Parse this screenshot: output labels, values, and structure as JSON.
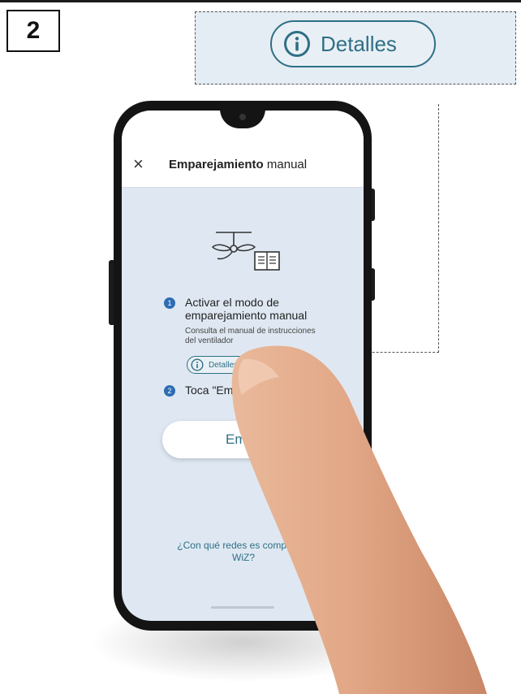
{
  "step_number": "2",
  "callout": {
    "label": "Detalles",
    "icon": "info-icon"
  },
  "app": {
    "close_icon": "×",
    "title_bold": "Emparejamiento",
    "title_rest": " manual",
    "steps": [
      {
        "number": "1",
        "title": "Activar el modo de emparejamiento manual",
        "subtitle": "Consulta el manual de instrucciones del ventilador",
        "details_label": "Detalles"
      },
      {
        "number": "2",
        "title": "Toca \"Empezar\""
      }
    ],
    "start_button": "Empezar",
    "compat_link": "¿Con qué redes es compatible WiZ?"
  },
  "colors": {
    "accent": "#2f6f86",
    "step_badge": "#2d6db4",
    "screen_bg": "#dfe8f2",
    "callout_bg": "#e4ecf4"
  }
}
